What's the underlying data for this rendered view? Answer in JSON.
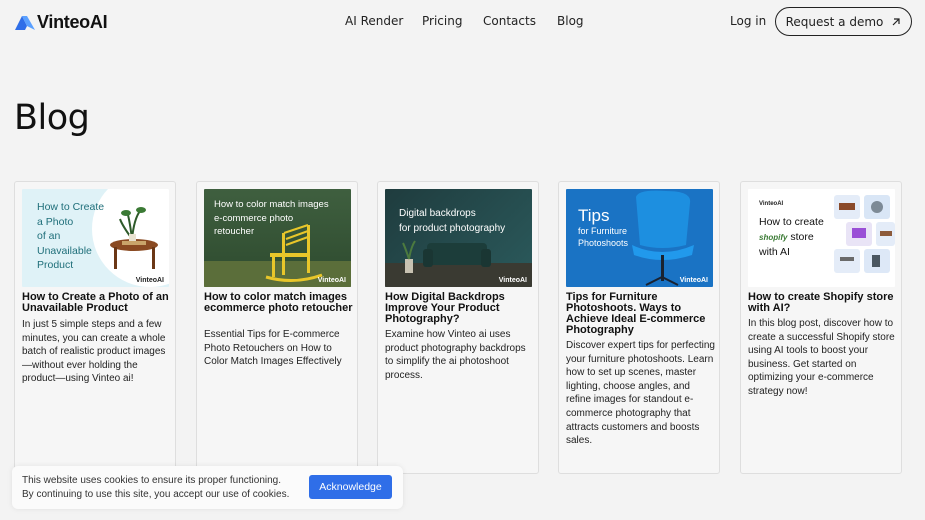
{
  "brand": {
    "name": "VinteoAI",
    "accent": "#2f6ee8"
  },
  "nav": {
    "items": [
      "AI Render",
      "Pricing",
      "Contacts",
      "Blog"
    ],
    "login": "Log in",
    "demo": "Request a demo"
  },
  "page": {
    "title": "Blog"
  },
  "posts": [
    {
      "thumb_text": [
        "How to Create",
        "a Photo",
        "of an",
        "Unavailable",
        "Product"
      ],
      "watermark": "VinteoAI",
      "title": "How to Create a Photo of an Unavailable Product",
      "desc": "In just 5 simple steps and a few minutes, you can create a whole batch of realistic product images—without ever holding the product—using Vinteo ai!"
    },
    {
      "thumb_text": [
        "How to color match images",
        "e-commerce photo",
        "retoucher"
      ],
      "watermark": "VinteoAI",
      "title": "How to color match images ecommerce photo retoucher",
      "desc": "Essential Tips for E-commerce Photo Retouchers on How to Color Match Images Effectively"
    },
    {
      "thumb_text": [
        "Digital backdrops",
        "for product photography"
      ],
      "watermark": "VinteoAI",
      "title": "How Digital Backdrops Improve Your Product Photography?",
      "desc": "Examine how Vinteo ai uses product photography backdrops to simplify the ai photoshoot process."
    },
    {
      "thumb_text": [
        "Tips",
        "for Furniture",
        "Photoshoots"
      ],
      "watermark": "VinteoAI",
      "title": "Tips for Furniture Photoshoots. Ways to Achieve Ideal E-commerce Photography",
      "desc": "Discover expert tips for perfecting your furniture photoshoots. Learn how to set up scenes, master lighting, choose angles, and refine images for standout e-commerce photography that attracts customers and boosts sales."
    },
    {
      "thumb_text": [
        "How to create",
        "shopify",
        "store",
        "with AI"
      ],
      "watermark": "VinteoAI",
      "title": "How to create Shopify store with AI?",
      "desc": "In this blog post, discover how to create a successful Shopify store using AI tools to boost your business. Get started on optimizing your e-commerce strategy now!"
    }
  ],
  "cookie": {
    "line1": "This website uses cookies to ensure its proper functioning.",
    "line2": "By continuing to use this site, you accept our use of cookies.",
    "button": "Acknowledge"
  }
}
